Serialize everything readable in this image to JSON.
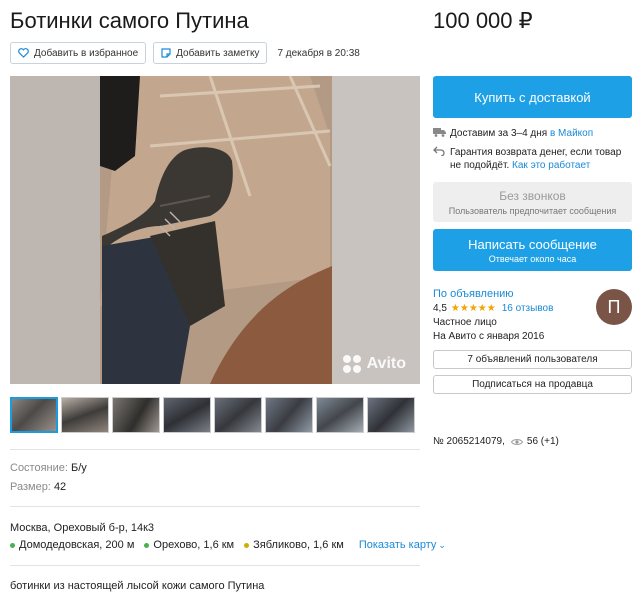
{
  "listing": {
    "title": "Ботинки самого Путина",
    "price": "100 000 ₽",
    "favorite_label": "Добавить в избранное",
    "note_label": "Добавить заметку",
    "date": "7 декабря в 20:38",
    "watermark": "Avito",
    "thumb_count": 8
  },
  "params": {
    "condition_key": "Состояние:",
    "condition_value": "Б/у",
    "size_key": "Размер:",
    "size_value": "42"
  },
  "location": {
    "address": "Москва, Ореховый б-р, 14к3",
    "metro": [
      {
        "name": "Домодедовская, 200 м",
        "color": "#4caf50"
      },
      {
        "name": "Орехово, 1,6 км",
        "color": "#4caf50"
      },
      {
        "name": "Зябликово, 1,6 км",
        "color": "#c8b400"
      }
    ],
    "map_link": "Показать карту"
  },
  "description": "ботинки из настоящей лысой кожи самого Путина",
  "sidebar": {
    "buy_button": "Купить с доставкой",
    "delivery_text": "Доставим за 3–4 дня",
    "delivery_city": "в Майкоп",
    "guarantee_line1": "Гарантия возврата денег, если товар",
    "guarantee_line2": "не подойдёт.",
    "guarantee_link": "Как это работает",
    "nocall_title": "Без звонков",
    "nocall_sub": "Пользователь предпочитает сообщения",
    "message_title": "Написать сообщение",
    "message_sub": "Отвечает около часа",
    "accent_color": "#1ea0e6"
  },
  "seller": {
    "name": "По объявлению",
    "rating": "4,5",
    "stars": "★★★★★",
    "reviews": "16 отзывов",
    "type": "Частное лицо",
    "since": "На Авито с января 2016",
    "avatar_letter": "П",
    "avatar_color": "#7a5547",
    "listings_button": "7 объявлений пользователя",
    "subscribe_button": "Подписаться на продавца"
  },
  "meta": {
    "item_number": "№ 2065214079,",
    "views": "56 (+1)"
  }
}
